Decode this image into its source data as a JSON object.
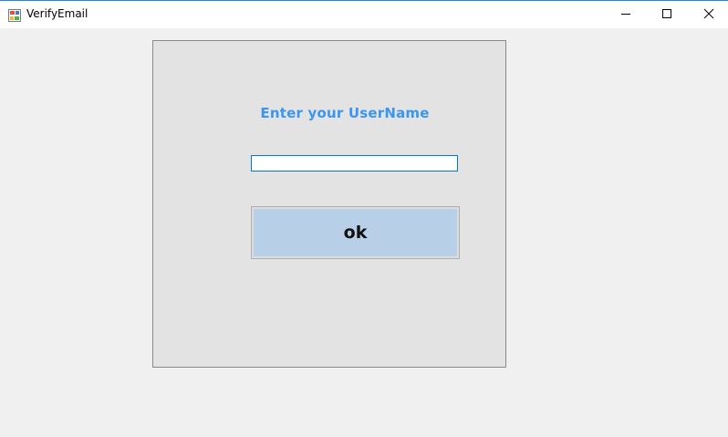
{
  "window": {
    "title": "VerifyEmail",
    "icon": "app-window-icon"
  },
  "controls": {
    "minimize_icon": "minimize-icon",
    "maximize_icon": "maximize-icon",
    "close_icon": "close-icon"
  },
  "form": {
    "prompt": "Enter your UserName",
    "username_value": "",
    "ok_label": "ok"
  },
  "colors": {
    "accent": "#3b97ee",
    "button_fill": "#b8cfe8",
    "panel_bg": "#e3e3e3",
    "input_border": "#0078d7"
  }
}
